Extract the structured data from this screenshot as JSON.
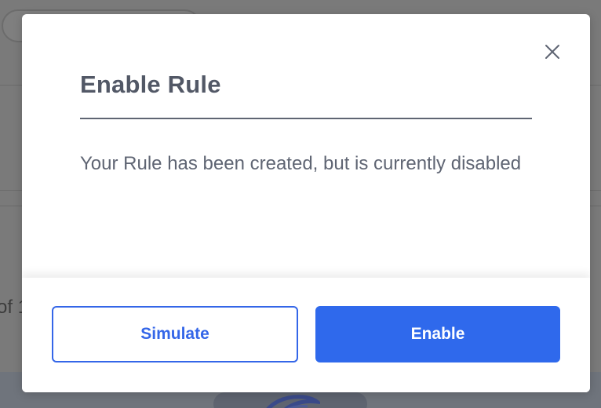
{
  "background": {
    "partial_text": "of 1"
  },
  "modal": {
    "title": "Enable Rule",
    "message": "Your Rule has been created, but is currently disabled",
    "close_icon": "close-icon",
    "buttons": {
      "simulate_label": "Simulate",
      "enable_label": "Enable"
    }
  },
  "colors": {
    "primary": "#2f69ec",
    "title_text": "#525866",
    "body_text": "#5f6573",
    "overlay": "#7a7a7a"
  }
}
